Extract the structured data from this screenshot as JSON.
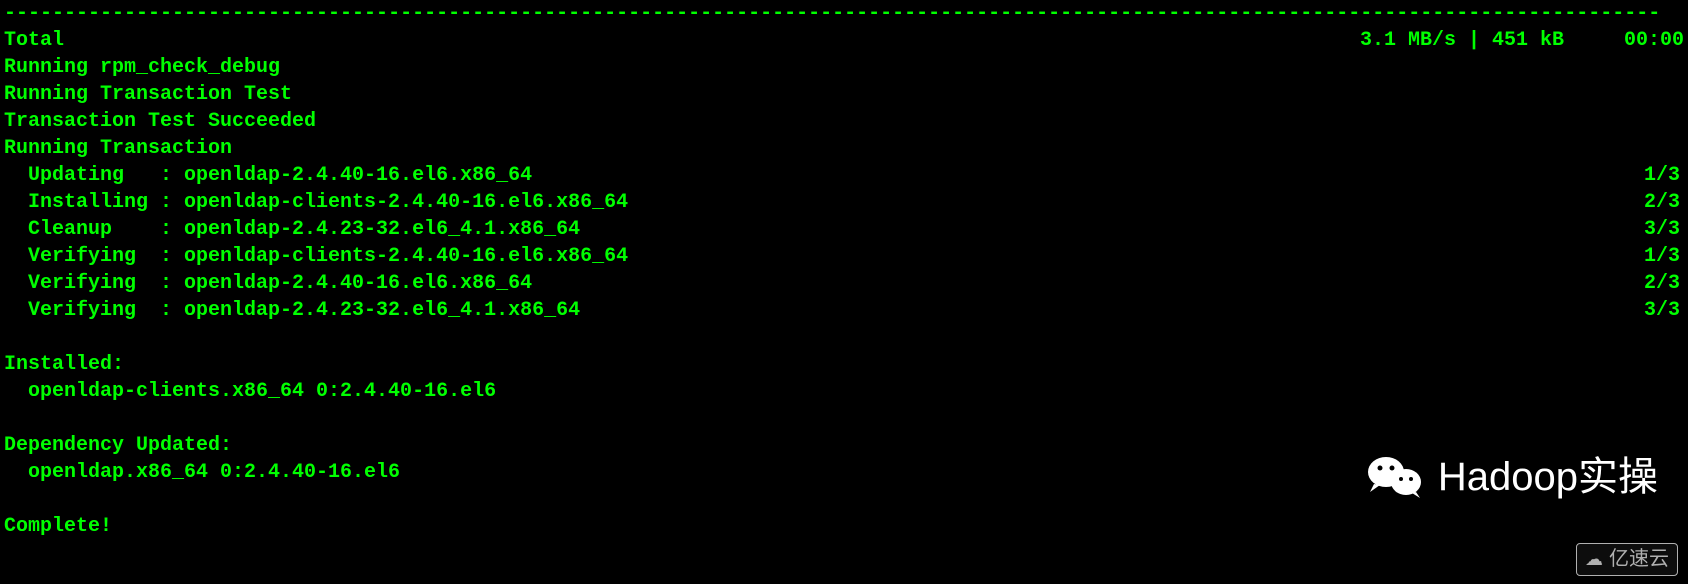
{
  "separator": "------------------------------------------------------------------------------------------------------------------------------------------",
  "total": {
    "label": "Total",
    "stats": "3.1 MB/s | 451 kB     00:00"
  },
  "lines": {
    "rpm_check": "Running rpm_check_debug",
    "trans_test": "Running Transaction Test",
    "trans_succeeded": "Transaction Test Succeeded",
    "running_trans": "Running Transaction"
  },
  "transactions": [
    {
      "action": "Updating   : openldap-2.4.40-16.el6.x86_64",
      "count": "1/3"
    },
    {
      "action": "Installing : openldap-clients-2.4.40-16.el6.x86_64",
      "count": "2/3"
    },
    {
      "action": "Cleanup    : openldap-2.4.23-32.el6_4.1.x86_64",
      "count": "3/3"
    },
    {
      "action": "Verifying  : openldap-clients-2.4.40-16.el6.x86_64",
      "count": "1/3"
    },
    {
      "action": "Verifying  : openldap-2.4.40-16.el6.x86_64",
      "count": "2/3"
    },
    {
      "action": "Verifying  : openldap-2.4.23-32.el6_4.1.x86_64",
      "count": "3/3"
    }
  ],
  "installed": {
    "header": "Installed:",
    "package": "openldap-clients.x86_64 0:2.4.40-16.el6"
  },
  "dependency": {
    "header": "Dependency Updated:",
    "package": "openldap.x86_64 0:2.4.40-16.el6"
  },
  "complete": "Complete!",
  "watermark_wechat": "Hadoop实操",
  "watermark_yisu": "亿速云"
}
